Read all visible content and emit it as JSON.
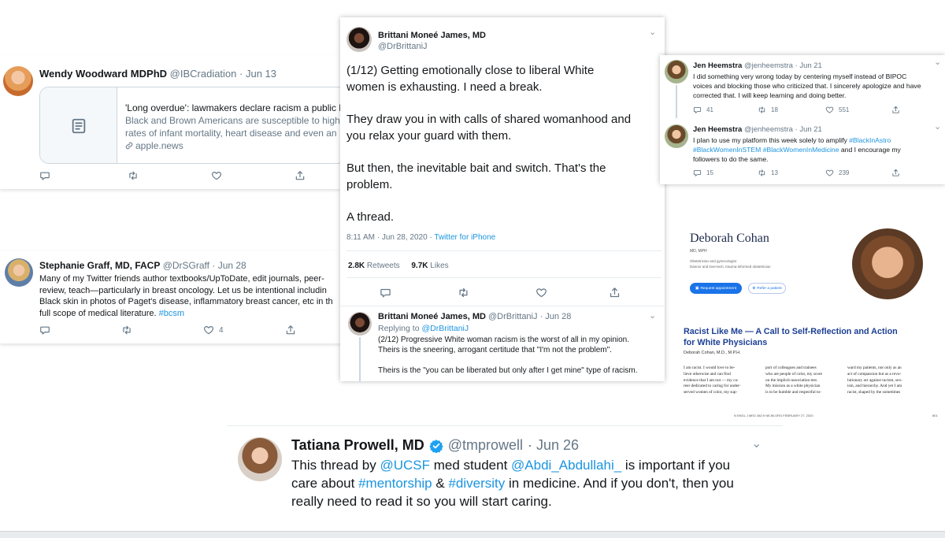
{
  "wendy": {
    "name": "Wendy Woodward MDPhD",
    "handle": "@IBCradiation",
    "date": "· Jun 13",
    "link_card": {
      "title": "'Long overdue': lawmakers declare racism a public he",
      "desc_1": "Black and Brown Americans are susceptible to higher",
      "desc_2": "rates of infant mortality, heart disease and even an ...",
      "domain": "apple.news"
    }
  },
  "stephanie": {
    "name": "Stephanie Graff, MD, FACP",
    "handle": "@DrSGraff",
    "date": "· Jun 28",
    "lines": [
      "Many of my Twitter friends author textbooks/UpToDate, edit journals, peer-",
      "review, teach—particularly in breast oncology. Let us be intentional includin",
      "Black skin in photos of Paget's disease, inflammatory breast cancer, etc in th",
      "full scope of medical literature."
    ],
    "hashtag": "#bcsm",
    "like_count": "4"
  },
  "brittani_main": {
    "name": "Brittani Moneé James, MD",
    "handle": "@DrBrittaniJ",
    "paragraphs": [
      [
        "(1/12) Getting emotionally close to liberal White",
        "women is exhausting. I need a break."
      ],
      [
        "They draw you in with calls of shared womanhood and",
        "you relax your guard with them."
      ],
      [
        "But then, the inevitable bait and switch. That's the",
        "problem."
      ],
      [
        "A thread."
      ]
    ],
    "meta_time": "8:11 AM · Jun 28, 2020 ·",
    "meta_source": "Twitter for iPhone",
    "retweets_count": "2.8K",
    "retweets_label": "Retweets",
    "likes_count": "9.7K",
    "likes_label": "Likes"
  },
  "brittani_reply": {
    "name": "Brittani Moneé James, MD",
    "handle": "@DrBrittaniJ",
    "date": "· Jun 28",
    "replying_label": "Replying to",
    "replying_to": "@DrBrittaniJ",
    "lines": [
      "(2/12) Progressive White woman racism is the worst of all in my opinion.",
      "Theirs is the sneering, arrogant certitude that \"I'm not the problem\".",
      "",
      "Theirs is the \"you can be liberated but only after I get mine\" type of racism."
    ]
  },
  "jen_1": {
    "name": "Jen Heemstra",
    "handle": "@jenheemstra",
    "date": "· Jun 21",
    "lines": [
      "I did something very wrong today by centering myself instead of BIPOC",
      "voices and blocking those who criticized that. I sincerely apologize and have",
      "corrected that. I will keep learning and doing better."
    ],
    "replies": "41",
    "retweets": "18",
    "likes": "551"
  },
  "jen_2": {
    "name": "Jen Heemstra",
    "handle": "@jenheemstra",
    "date": "· Jun 21",
    "line_1": "I plan to use my platform this week solely to amplify",
    "tag_1": "#BlackInAstro",
    "tag_2": "#BlackWomenInSTEM",
    "tag_3": "#BlackWomenInMedicine",
    "line_2_tail": "and I encourage my",
    "line_3": "followers to do the same.",
    "replies": "15",
    "retweets": "13",
    "likes": "239"
  },
  "deborah": {
    "name": "Deborah Cohan",
    "credentials": "MD, MPH",
    "role_1": "Obstetrician and gynecologist",
    "role_2": "Dancer and love-tech, trauma-informed obstetrician",
    "btn_primary": "Request appointment",
    "btn_secondary": "Refer a patient"
  },
  "article": {
    "title_1": "Racist Like Me — A Call to Self-Reflection and Action",
    "title_2": "for White Physicians",
    "author": "Deborah Cohan, M.D., M.P.H.",
    "col_1": [
      "I am racist. I would love to be-",
      "lieve otherwise and can find",
      "evidence that I am not — my ca-",
      "reer dedicated to caring for under-",
      "served women of color, my sup-"
    ],
    "col_2": [
      "port of colleagues and trainees",
      "who are people of color, my score",
      "on the implicit-association test.",
      "My mission as a white physician",
      "is to be humble and respectful to-"
    ],
    "col_3": [
      "ward my patients, not only as an",
      "act of compassion but as a revo-",
      "lutionary act against racism, sex-",
      "ism, and hierarchy. And yet I am",
      "racist, shaped by the sometimes"
    ],
    "footer_left": "N ENGL J MED 382;9   NEJM.ORG   FEBRUARY 27, 2020",
    "footer_right": "801"
  },
  "tatiana": {
    "name": "Tatiana Prowell, MD",
    "handle": "@tmprowell",
    "date": "· Jun 26",
    "l1_a": "This thread by",
    "l1_b": "@UCSF",
    "l1_c": "med student",
    "l1_d": "@Abdi_Abdullahi_",
    "l1_e": "is important if you",
    "l2_a": "care about",
    "l2_b": "#mentorship",
    "l2_c": "&",
    "l2_d": "#diversity",
    "l2_e": "in medicine. And if you don't, then you",
    "l3": "really need to read it so you will start caring."
  },
  "colors": {
    "link": "#1b95e0",
    "muted": "#657786",
    "verified": "#1da1f2",
    "nejm_blue": "#1c3f94"
  }
}
